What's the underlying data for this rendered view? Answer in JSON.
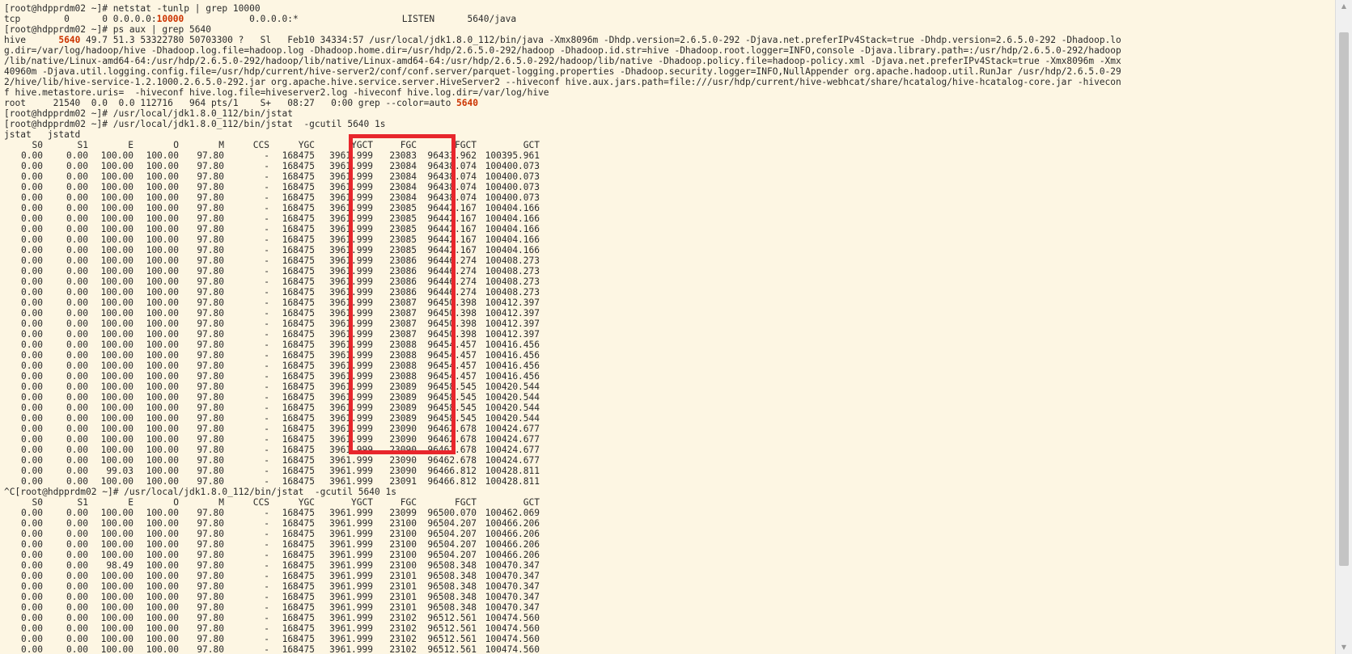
{
  "terminal": {
    "lines": [
      [
        {
          "t": "[root@hdpprdm02 ~]# netstat -tunlp | grep 10000"
        }
      ],
      [
        {
          "t": "tcp        0      0 0.0.0.0:"
        },
        {
          "t": "10000",
          "hl": true
        },
        {
          "t": "            0.0.0.0:*                   LISTEN      5640/java"
        }
      ],
      [
        {
          "t": "[root@hdpprdm02 ~]# ps aux | grep 5640"
        }
      ],
      [
        {
          "t": "hive      "
        },
        {
          "t": "5640",
          "hl": true
        },
        {
          "t": " 49.7 51.3 53322780 50703300 ?   Sl   Feb10 34334:57 /usr/local/jdk1.8.0_112/bin/java -Xmx8096m -Dhdp.version=2.6.5.0-292 -Djava.net.preferIPv4Stack=true -Dhdp.version=2.6.5.0-292 -Dhadoop.lo"
        }
      ],
      [
        {
          "t": "g.dir=/var/log/hadoop/hive -Dhadoop.log.file=hadoop.log -Dhadoop.home.dir=/usr/hdp/2.6.5.0-292/hadoop -Dhadoop.id.str=hive -Dhadoop.root.logger=INFO,console -Djava.library.path=:/usr/hdp/2.6.5.0-292/hadoop"
        }
      ],
      [
        {
          "t": "/lib/native/Linux-amd64-64:/usr/hdp/2.6.5.0-292/hadoop/lib/native/Linux-amd64-64:/usr/hdp/2.6.5.0-292/hadoop/lib/native -Dhadoop.policy.file=hadoop-policy.xml -Djava.net.preferIPv4Stack=true -Xmx8096m -Xmx"
        }
      ],
      [
        {
          "t": "40960m -Djava.util.logging.config.file=/usr/hdp/current/hive-server2/conf/conf.server/parquet-logging.properties -Dhadoop.security.logger=INFO,NullAppender org.apache.hadoop.util.RunJar /usr/hdp/2.6.5.0-29"
        }
      ],
      [
        {
          "t": "2/hive/lib/hive-service-1.2.1000.2.6.5.0-292.jar org.apache.hive.service.server.HiveServer2 --hiveconf hive.aux.jars.path=file:///usr/hdp/current/hive-webhcat/share/hcatalog/hive-hcatalog-core.jar -hivecon"
        }
      ],
      [
        {
          "t": "f hive.metastore.uris=  -hiveconf hive.log.file=hiveserver2.log -hiveconf hive.log.dir=/var/log/hive"
        }
      ],
      [
        {
          "t": "root     21540  0.0  0.0 112716   964 pts/1    S+   08:27   0:00 grep --color=auto "
        },
        {
          "t": "5640",
          "hl": true
        }
      ],
      [
        {
          "t": "[root@hdpprdm02 ~]# /usr/local/jdk1.8.0_112/bin/jstat"
        }
      ],
      [
        {
          "t": "[root@hdpprdm02 ~]# /usr/local/jdk1.8.0_112/bin/jstat  -gcutil 5640 1s"
        }
      ],
      [
        {
          "t": "jstat   jstatd"
        }
      ]
    ],
    "jstat_headers": [
      "S0",
      "S1",
      "E",
      "O",
      "M",
      "CCS",
      "YGC",
      "YGCT",
      "FGC",
      "FGCT",
      "GCT"
    ],
    "jstat_rows_1": [
      [
        "0.00",
        "0.00",
        "100.00",
        "100.00",
        "97.80",
        "-",
        "168475",
        "3961.999",
        "23083",
        "96433.962",
        "100395.961"
      ],
      [
        "0.00",
        "0.00",
        "100.00",
        "100.00",
        "97.80",
        "-",
        "168475",
        "3961.999",
        "23084",
        "96438.074",
        "100400.073"
      ],
      [
        "0.00",
        "0.00",
        "100.00",
        "100.00",
        "97.80",
        "-",
        "168475",
        "3961.999",
        "23084",
        "96438.074",
        "100400.073"
      ],
      [
        "0.00",
        "0.00",
        "100.00",
        "100.00",
        "97.80",
        "-",
        "168475",
        "3961.999",
        "23084",
        "96438.074",
        "100400.073"
      ],
      [
        "0.00",
        "0.00",
        "100.00",
        "100.00",
        "97.80",
        "-",
        "168475",
        "3961.999",
        "23084",
        "96438.074",
        "100400.073"
      ],
      [
        "0.00",
        "0.00",
        "100.00",
        "100.00",
        "97.80",
        "-",
        "168475",
        "3961.999",
        "23085",
        "96442.167",
        "100404.166"
      ],
      [
        "0.00",
        "0.00",
        "100.00",
        "100.00",
        "97.80",
        "-",
        "168475",
        "3961.999",
        "23085",
        "96442.167",
        "100404.166"
      ],
      [
        "0.00",
        "0.00",
        "100.00",
        "100.00",
        "97.80",
        "-",
        "168475",
        "3961.999",
        "23085",
        "96442.167",
        "100404.166"
      ],
      [
        "0.00",
        "0.00",
        "100.00",
        "100.00",
        "97.80",
        "-",
        "168475",
        "3961.999",
        "23085",
        "96442.167",
        "100404.166"
      ],
      [
        "0.00",
        "0.00",
        "100.00",
        "100.00",
        "97.80",
        "-",
        "168475",
        "3961.999",
        "23085",
        "96442.167",
        "100404.166"
      ],
      [
        "0.00",
        "0.00",
        "100.00",
        "100.00",
        "97.80",
        "-",
        "168475",
        "3961.999",
        "23086",
        "96446.274",
        "100408.273"
      ],
      [
        "0.00",
        "0.00",
        "100.00",
        "100.00",
        "97.80",
        "-",
        "168475",
        "3961.999",
        "23086",
        "96446.274",
        "100408.273"
      ],
      [
        "0.00",
        "0.00",
        "100.00",
        "100.00",
        "97.80",
        "-",
        "168475",
        "3961.999",
        "23086",
        "96446.274",
        "100408.273"
      ],
      [
        "0.00",
        "0.00",
        "100.00",
        "100.00",
        "97.80",
        "-",
        "168475",
        "3961.999",
        "23086",
        "96446.274",
        "100408.273"
      ],
      [
        "0.00",
        "0.00",
        "100.00",
        "100.00",
        "97.80",
        "-",
        "168475",
        "3961.999",
        "23087",
        "96450.398",
        "100412.397"
      ],
      [
        "0.00",
        "0.00",
        "100.00",
        "100.00",
        "97.80",
        "-",
        "168475",
        "3961.999",
        "23087",
        "96450.398",
        "100412.397"
      ],
      [
        "0.00",
        "0.00",
        "100.00",
        "100.00",
        "97.80",
        "-",
        "168475",
        "3961.999",
        "23087",
        "96450.398",
        "100412.397"
      ],
      [
        "0.00",
        "0.00",
        "100.00",
        "100.00",
        "97.80",
        "-",
        "168475",
        "3961.999",
        "23087",
        "96450.398",
        "100412.397"
      ],
      [
        "0.00",
        "0.00",
        "100.00",
        "100.00",
        "97.80",
        "-",
        "168475",
        "3961.999",
        "23088",
        "96454.457",
        "100416.456"
      ],
      [
        "0.00",
        "0.00",
        "100.00",
        "100.00",
        "97.80",
        "-",
        "168475",
        "3961.999",
        "23088",
        "96454.457",
        "100416.456"
      ],
      [
        "0.00",
        "0.00",
        "100.00",
        "100.00",
        "97.80",
        "-",
        "168475",
        "3961.999",
        "23088",
        "96454.457",
        "100416.456"
      ],
      [
        "0.00",
        "0.00",
        "100.00",
        "100.00",
        "97.80",
        "-",
        "168475",
        "3961.999",
        "23088",
        "96454.457",
        "100416.456"
      ],
      [
        "0.00",
        "0.00",
        "100.00",
        "100.00",
        "97.80",
        "-",
        "168475",
        "3961.999",
        "23089",
        "96458.545",
        "100420.544"
      ],
      [
        "0.00",
        "0.00",
        "100.00",
        "100.00",
        "97.80",
        "-",
        "168475",
        "3961.999",
        "23089",
        "96458.545",
        "100420.544"
      ],
      [
        "0.00",
        "0.00",
        "100.00",
        "100.00",
        "97.80",
        "-",
        "168475",
        "3961.999",
        "23089",
        "96458.545",
        "100420.544"
      ],
      [
        "0.00",
        "0.00",
        "100.00",
        "100.00",
        "97.80",
        "-",
        "168475",
        "3961.999",
        "23089",
        "96458.545",
        "100420.544"
      ],
      [
        "0.00",
        "0.00",
        "100.00",
        "100.00",
        "97.80",
        "-",
        "168475",
        "3961.999",
        "23090",
        "96462.678",
        "100424.677"
      ],
      [
        "0.00",
        "0.00",
        "100.00",
        "100.00",
        "97.80",
        "-",
        "168475",
        "3961.999",
        "23090",
        "96462.678",
        "100424.677"
      ],
      [
        "0.00",
        "0.00",
        "100.00",
        "100.00",
        "97.80",
        "-",
        "168475",
        "3961.999",
        "23090",
        "96462.678",
        "100424.677"
      ],
      [
        "0.00",
        "0.00",
        "100.00",
        "100.00",
        "97.80",
        "-",
        "168475",
        "3961.999",
        "23090",
        "96462.678",
        "100424.677"
      ],
      [
        "0.00",
        "0.00",
        "99.03",
        "100.00",
        "97.80",
        "-",
        "168475",
        "3961.999",
        "23090",
        "96466.812",
        "100428.811"
      ],
      [
        "0.00",
        "0.00",
        "100.00",
        "100.00",
        "97.80",
        "-",
        "168475",
        "3961.999",
        "23091",
        "96466.812",
        "100428.811"
      ]
    ],
    "second_command": "^C[root@hdpprdm02 ~]# /usr/local/jdk1.8.0_112/bin/jstat  -gcutil 5640 1s",
    "jstat_rows_2": [
      [
        "0.00",
        "0.00",
        "100.00",
        "100.00",
        "97.80",
        "-",
        "168475",
        "3961.999",
        "23099",
        "96500.070",
        "100462.069"
      ],
      [
        "0.00",
        "0.00",
        "100.00",
        "100.00",
        "97.80",
        "-",
        "168475",
        "3961.999",
        "23100",
        "96504.207",
        "100466.206"
      ],
      [
        "0.00",
        "0.00",
        "100.00",
        "100.00",
        "97.80",
        "-",
        "168475",
        "3961.999",
        "23100",
        "96504.207",
        "100466.206"
      ],
      [
        "0.00",
        "0.00",
        "100.00",
        "100.00",
        "97.80",
        "-",
        "168475",
        "3961.999",
        "23100",
        "96504.207",
        "100466.206"
      ],
      [
        "0.00",
        "0.00",
        "100.00",
        "100.00",
        "97.80",
        "-",
        "168475",
        "3961.999",
        "23100",
        "96504.207",
        "100466.206"
      ],
      [
        "0.00",
        "0.00",
        "98.49",
        "100.00",
        "97.80",
        "-",
        "168475",
        "3961.999",
        "23100",
        "96508.348",
        "100470.347"
      ],
      [
        "0.00",
        "0.00",
        "100.00",
        "100.00",
        "97.80",
        "-",
        "168475",
        "3961.999",
        "23101",
        "96508.348",
        "100470.347"
      ],
      [
        "0.00",
        "0.00",
        "100.00",
        "100.00",
        "97.80",
        "-",
        "168475",
        "3961.999",
        "23101",
        "96508.348",
        "100470.347"
      ],
      [
        "0.00",
        "0.00",
        "100.00",
        "100.00",
        "97.80",
        "-",
        "168475",
        "3961.999",
        "23101",
        "96508.348",
        "100470.347"
      ],
      [
        "0.00",
        "0.00",
        "100.00",
        "100.00",
        "97.80",
        "-",
        "168475",
        "3961.999",
        "23101",
        "96508.348",
        "100470.347"
      ],
      [
        "0.00",
        "0.00",
        "100.00",
        "100.00",
        "97.80",
        "-",
        "168475",
        "3961.999",
        "23102",
        "96512.561",
        "100474.560"
      ],
      [
        "0.00",
        "0.00",
        "100.00",
        "100.00",
        "97.80",
        "-",
        "168475",
        "3961.999",
        "23102",
        "96512.561",
        "100474.560"
      ],
      [
        "0.00",
        "0.00",
        "100.00",
        "100.00",
        "97.80",
        "-",
        "168475",
        "3961.999",
        "23102",
        "96512.561",
        "100474.560"
      ],
      [
        "0.00",
        "0.00",
        "100.00",
        "100.00",
        "97.80",
        "-",
        "168475",
        "3961.999",
        "23102",
        "96512.561",
        "100474.560"
      ]
    ]
  },
  "colors": {
    "background": "#fdf6e3",
    "text": "#2a2a2a",
    "highlight_text": "#cc3300",
    "annotation_box": "#e8262c"
  },
  "icons": {
    "scroll_up": "scroll-up-arrow-icon",
    "scroll_down": "scroll-down-arrow-icon"
  }
}
